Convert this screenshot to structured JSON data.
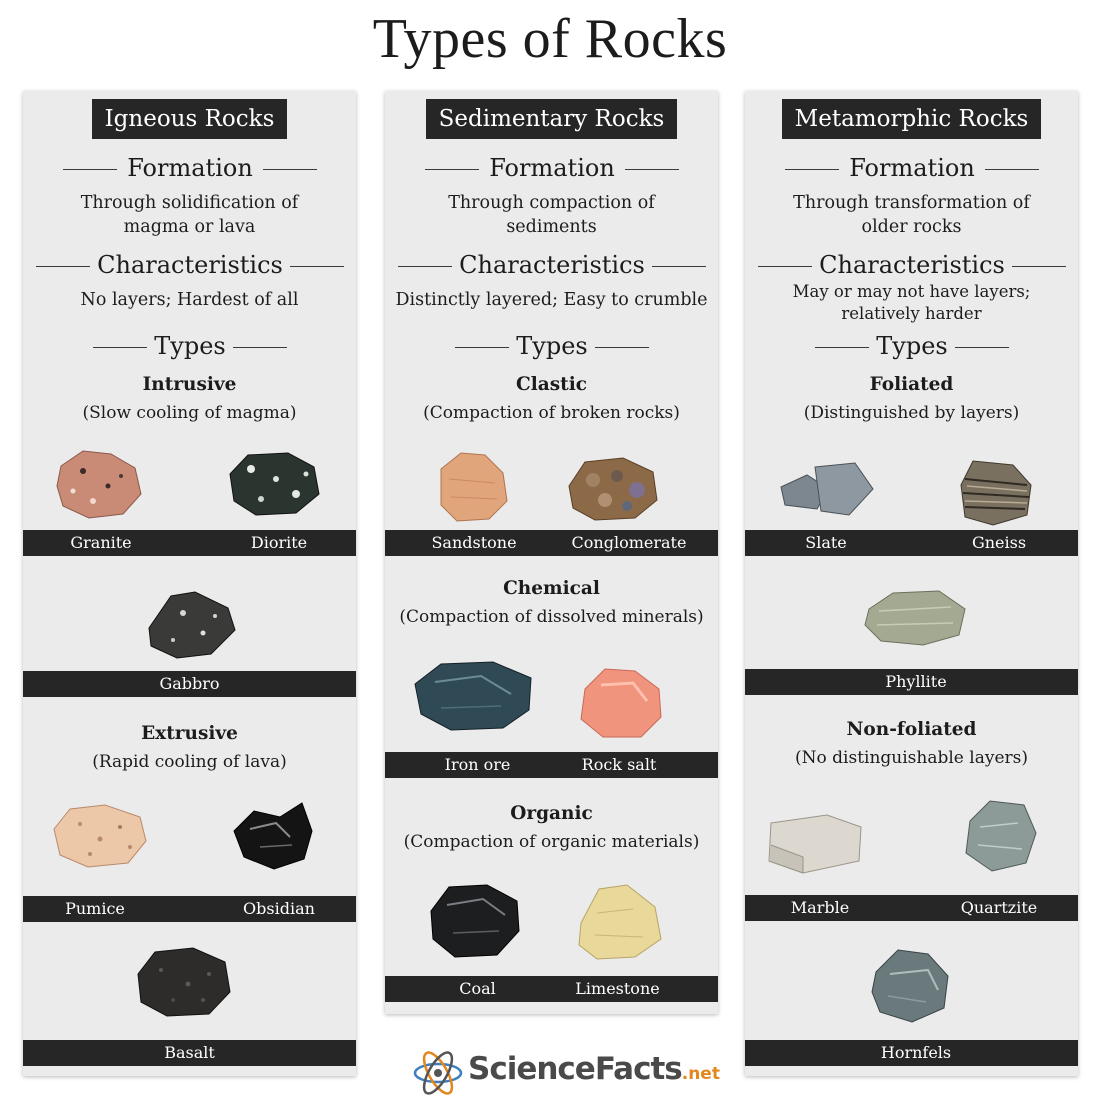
{
  "title": "Types of Rocks",
  "colors": {
    "panel": "#ebebeb",
    "dark_bar": "#262626",
    "brand_accent": "#e2861d"
  },
  "columns": [
    {
      "header": "Igneous Rocks",
      "formation_label": "Formation",
      "formation_text": [
        "Through solidification of",
        "magma or lava"
      ],
      "characteristics_label": "Characteristics",
      "characteristics_text": [
        "No layers; Hardest of all"
      ],
      "types_label": "Types",
      "groups": [
        {
          "name": "Intrusive",
          "description": "(Slow cooling of magma)",
          "rocks": [
            "Granite",
            "Diorite",
            "Gabbro"
          ]
        },
        {
          "name": "Extrusive",
          "description": "(Rapid cooling of lava)",
          "rocks": [
            "Pumice",
            "Obsidian",
            "Basalt"
          ]
        }
      ]
    },
    {
      "header": "Sedimentary Rocks",
      "formation_label": "Formation",
      "formation_text": [
        "Through compaction of",
        "sediments"
      ],
      "characteristics_label": "Characteristics",
      "characteristics_text": [
        "Distinctly layered; Easy to crumble"
      ],
      "types_label": "Types",
      "groups": [
        {
          "name": "Clastic",
          "description": "(Compaction of broken rocks)",
          "rocks": [
            "Sandstone",
            "Conglomerate"
          ]
        },
        {
          "name": "Chemical",
          "description": "(Compaction of dissolved minerals)",
          "rocks": [
            "Iron ore",
            "Rock salt"
          ]
        },
        {
          "name": "Organic",
          "description": "(Compaction of organic materials)",
          "rocks": [
            "Coal",
            "Limestone"
          ]
        }
      ]
    },
    {
      "header": "Metamorphic Rocks",
      "formation_label": "Formation",
      "formation_text": [
        "Through transformation of",
        "older rocks"
      ],
      "characteristics_label": "Characteristics",
      "characteristics_text": [
        "May or may not have layers;",
        "relatively harder"
      ],
      "types_label": "Types",
      "groups": [
        {
          "name": "Foliated",
          "description": "(Distinguished by layers)",
          "rocks": [
            "Slate",
            "Gneiss",
            "Phyllite"
          ]
        },
        {
          "name": "Non-foliated",
          "description": "(No distinguishable layers)",
          "rocks": [
            "Marble",
            "Quartzite",
            "Hornfels"
          ]
        }
      ]
    }
  ],
  "footer": {
    "brand": "ScienceFacts",
    "brand_suffix": ".net",
    "logo_icon": "atom-icon"
  }
}
